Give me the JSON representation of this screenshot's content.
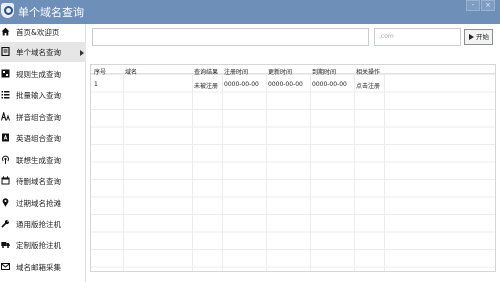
{
  "window": {
    "title": "单个域名查询",
    "minimize_label": "-",
    "close_label": "×"
  },
  "sidebar": {
    "items": [
      {
        "label": "首页&欢迎页",
        "icon": "home-icon",
        "active": false
      },
      {
        "label": "单个域名查询",
        "icon": "document-icon",
        "active": true
      },
      {
        "label": "规则生成查询",
        "icon": "grid-icon",
        "active": false
      },
      {
        "label": "批量输入查询",
        "icon": "list-icon",
        "active": false
      },
      {
        "label": "拼音组合查询",
        "icon": "pinyin-icon",
        "active": false
      },
      {
        "label": "英语组合查询",
        "icon": "book-icon",
        "active": false
      },
      {
        "label": "联想生成查询",
        "icon": "broadcast-icon",
        "active": false
      },
      {
        "label": "待删域名查询",
        "icon": "calendar-icon",
        "active": false
      },
      {
        "label": "过期域名抢滩",
        "icon": "map-pin-icon",
        "active": false
      },
      {
        "label": "通用版抢注机",
        "icon": "wrench-icon",
        "active": false
      },
      {
        "label": "定制版抢注机",
        "icon": "truck-icon",
        "active": false
      },
      {
        "label": "域名邮箱采集",
        "icon": "mail-icon",
        "active": false
      }
    ]
  },
  "search": {
    "domain_placeholder": "",
    "tld_value": ".com",
    "start_label": "开始"
  },
  "table": {
    "columns": [
      "序号",
      "域名",
      "查询结果",
      "注册时间",
      "更新时间",
      "到期时间",
      "相关操作"
    ],
    "rows": [
      [
        "1",
        "",
        "未被注册",
        "0000-00-00",
        "0000-00-00",
        "0000-00-00",
        "点击注册"
      ]
    ]
  }
}
